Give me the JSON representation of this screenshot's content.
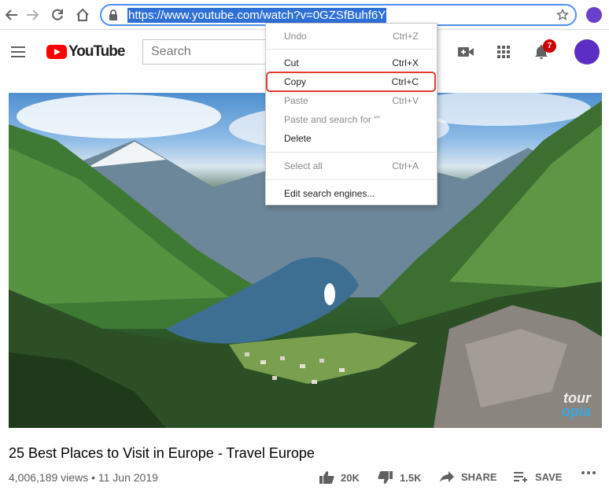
{
  "browser": {
    "url": "https://www.youtube.com/watch?v=0GZSfBuhf6Y"
  },
  "youtube": {
    "brand": "YouTube",
    "search_placeholder": "Search",
    "notification_count": "7"
  },
  "context_menu": {
    "items": [
      {
        "label": "Undo",
        "shortcut": "Ctrl+Z",
        "enabled": false
      },
      {
        "label": "Cut",
        "shortcut": "Ctrl+X",
        "enabled": true
      },
      {
        "label": "Copy",
        "shortcut": "Ctrl+C",
        "enabled": true,
        "highlighted": true
      },
      {
        "label": "Paste",
        "shortcut": "Ctrl+V",
        "enabled": false
      },
      {
        "label": "Paste and search for “”",
        "shortcut": "",
        "enabled": false
      },
      {
        "label": "Delete",
        "shortcut": "",
        "enabled": true
      },
      {
        "label": "Select all",
        "shortcut": "Ctrl+A",
        "enabled": false
      },
      {
        "label": "Edit search engines...",
        "shortcut": "",
        "enabled": true
      }
    ]
  },
  "video": {
    "watermark_line1": "tour",
    "watermark_line2": "opia",
    "title": "25 Best Places to Visit in Europe - Travel Europe",
    "views": "4,006,189 views",
    "separator": "•",
    "date": "11 Jun 2019",
    "likes": "20K",
    "dislikes": "1.5K",
    "share_label": "SHARE",
    "save_label": "SAVE"
  },
  "colors": {
    "accent": "#4d90fe",
    "yt_red": "#ff0000",
    "highlight_outline": "#e53935",
    "avatar": "#5b2fc4"
  }
}
